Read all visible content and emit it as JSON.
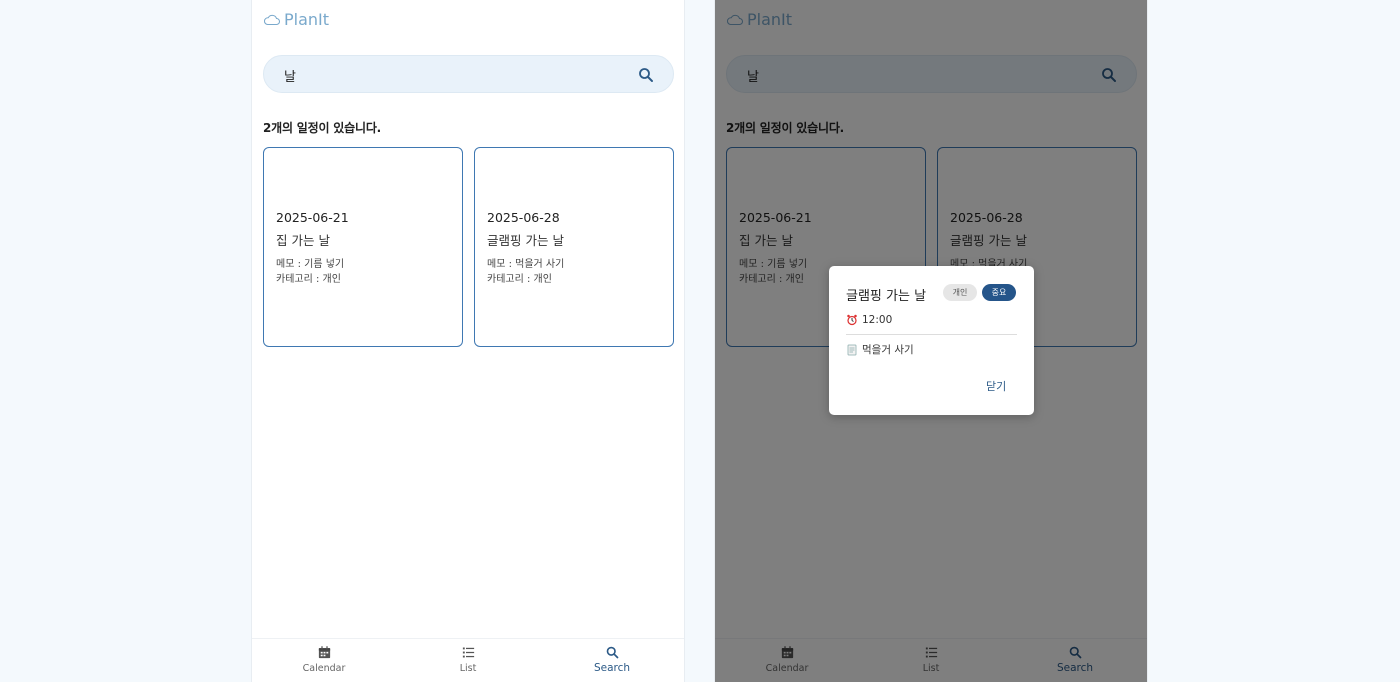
{
  "app": {
    "name": "PlanIt"
  },
  "search": {
    "value": "날"
  },
  "results": {
    "count_text": "2개의 일정이 있습니다.",
    "cards": [
      {
        "date": "2025-06-21",
        "title": "집 가는 날",
        "memo": "메모 : 기름 넣기",
        "category": "카테고리 : 개인"
      },
      {
        "date": "2025-06-28",
        "title": "글램핑 가는 날",
        "memo": "메모 : 먹을거 사기",
        "category": "카테고리 : 개인"
      }
    ]
  },
  "nav": {
    "items": [
      {
        "label": "Calendar",
        "icon": "calendar-icon"
      },
      {
        "label": "List",
        "icon": "list-icon"
      },
      {
        "label": "Search",
        "icon": "search-icon",
        "active": true
      }
    ]
  },
  "modal": {
    "title": "글램핑 가는 날",
    "category_badge": "개인",
    "priority_badge": "중요",
    "time": "12:00",
    "memo": "먹을거 사기",
    "close_label": "닫기"
  },
  "colors": {
    "accent": "#2c5a87",
    "card_border": "#3f78b2",
    "search_bg": "#e9f2fa",
    "logo": "#7aa9cc"
  }
}
